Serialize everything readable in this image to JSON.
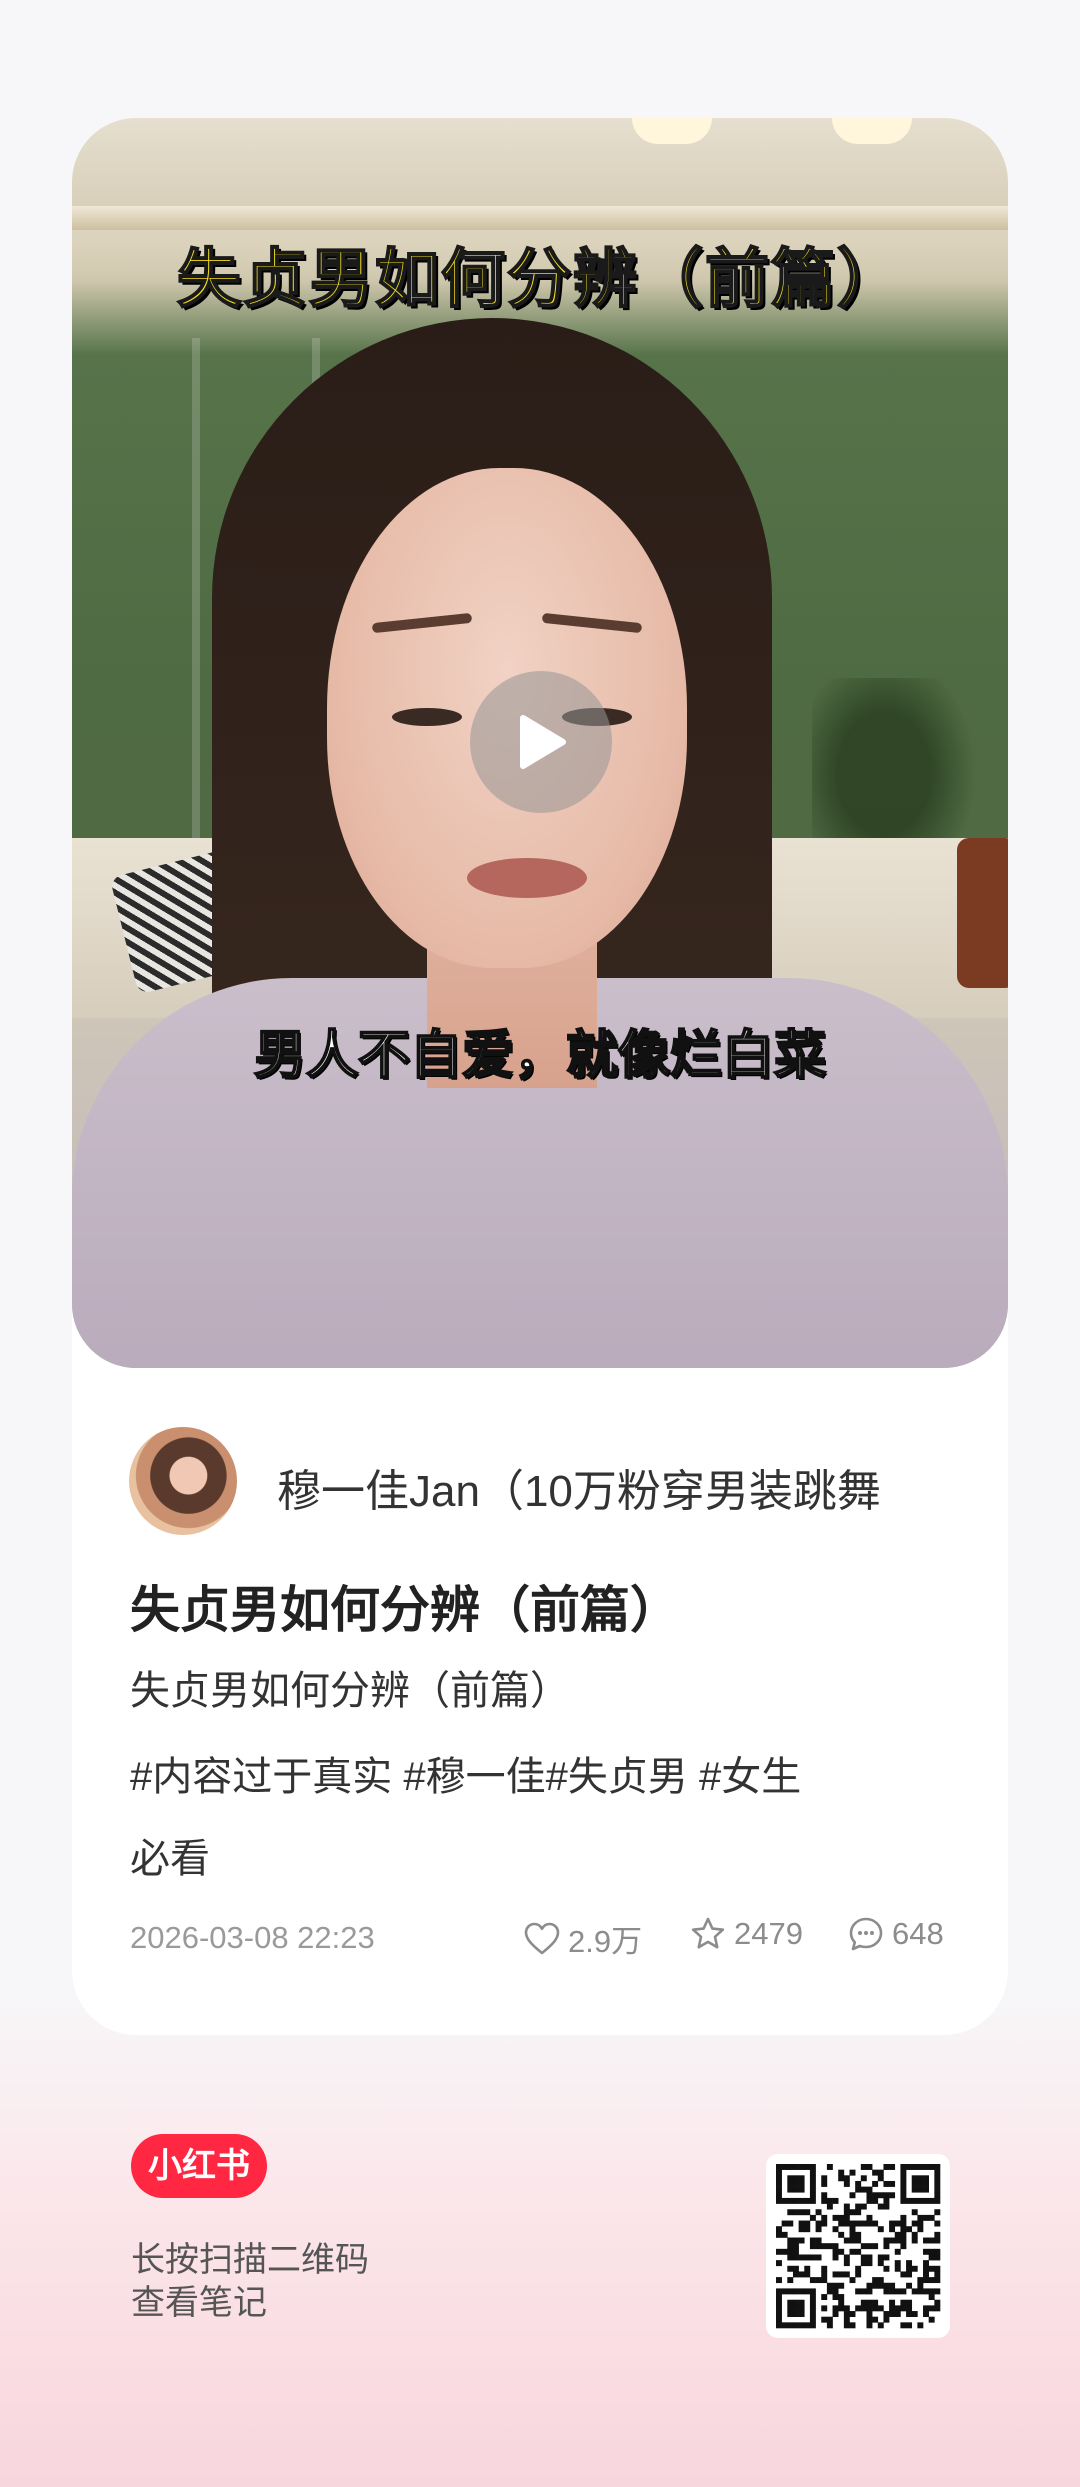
{
  "video": {
    "title_overlay": "失贞男如何分辨（前篇）",
    "subtitle_overlay": "男人不自爱，就像烂白菜"
  },
  "author": {
    "name": "穆一佳Jan（10万粉穿男装跳舞"
  },
  "post": {
    "title": "失贞男如何分辨（前篇）",
    "description": "失贞男如何分辨（前篇）",
    "tags_line1": "#内容过于真实 #穆一佳#失贞男 #女生",
    "tags_line2": "必看",
    "date": "2026-03-08 22:23",
    "likes": "2.9万",
    "favorites": "2479",
    "comments": "648"
  },
  "footer": {
    "brand": "小红书",
    "instruction_line1": "长按扫描二维码",
    "instruction_line2": "查看笔记"
  },
  "colors": {
    "brand_red": "#ff2741",
    "title_yellow": "#f3df1f",
    "background_pink": "#f8d6dd"
  },
  "icons": [
    "play-icon",
    "heart-icon",
    "star-icon",
    "comment-icon",
    "qr-code"
  ]
}
